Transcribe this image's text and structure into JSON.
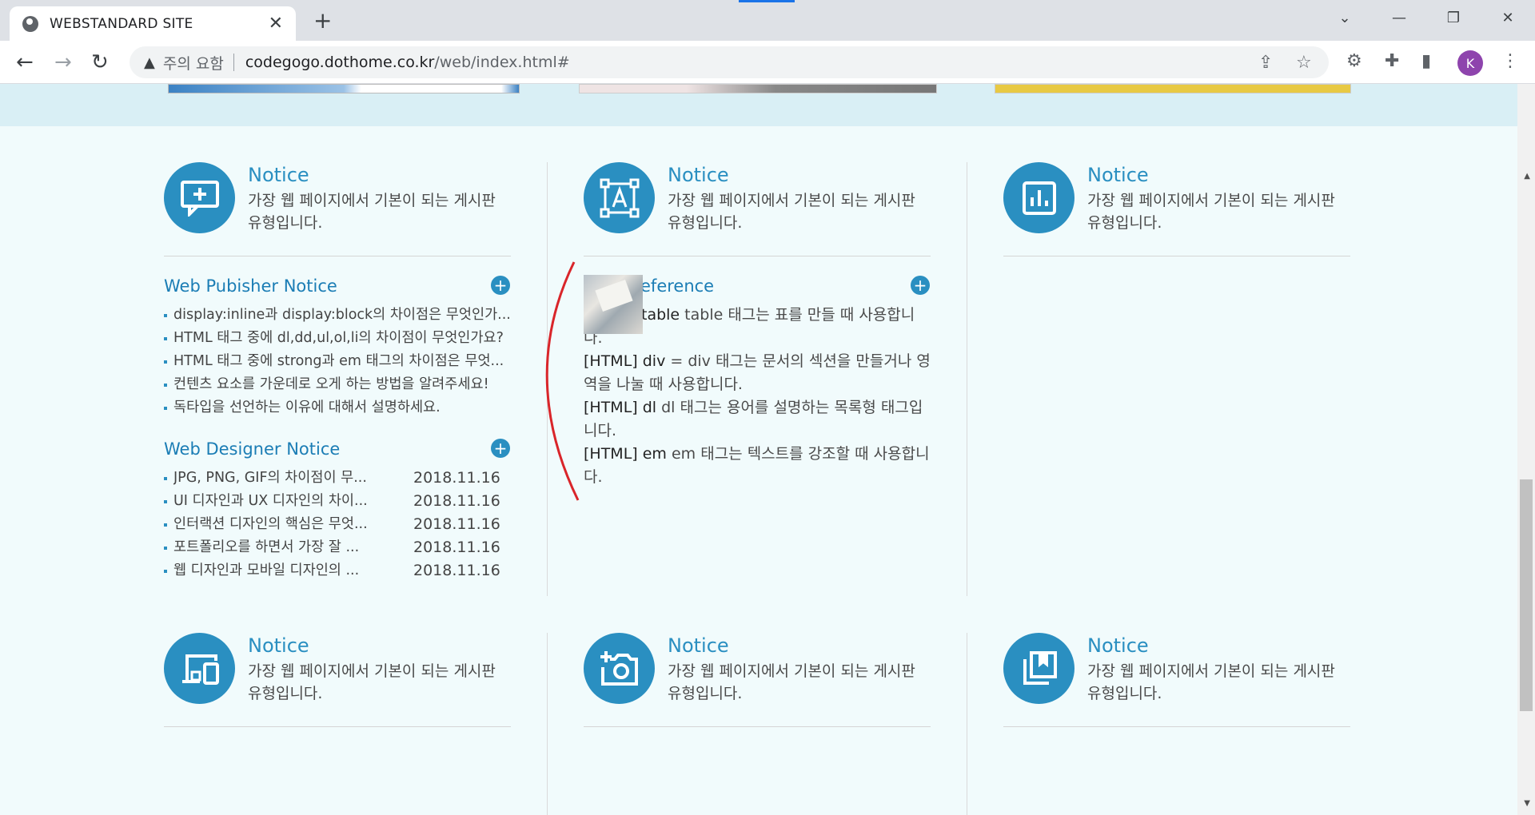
{
  "browser": {
    "tab_title": "WEBSTANDARD SITE",
    "security_warning": "주의 요함",
    "url_host": "codegogo.dothome.co.kr",
    "url_path": "/web/index.html#",
    "profile_initial": "K"
  },
  "columns": {
    "row1": [
      {
        "title": "Notice",
        "desc": "가장 웹 페이지에서 기본이 되는 게시판 유형입니다.",
        "icon": "add-comment-icon"
      },
      {
        "title": "Notice",
        "desc": "가장 웹 페이지에서 기본이 되는 게시판 유형입니다.",
        "icon": "text-frame-icon"
      },
      {
        "title": "Notice",
        "desc": "가장 웹 페이지에서 기본이 되는 게시판 유형입니다.",
        "icon": "bar-chart-icon"
      }
    ],
    "row2": [
      {
        "title": "Notice",
        "desc": "가장 웹 페이지에서 기본이 되는 게시판 유형입니다.",
        "icon": "devices-icon"
      },
      {
        "title": "Notice",
        "desc": "가장 웹 페이지에서 기본이 되는 게시판 유형입니다.",
        "icon": "add-photo-icon"
      },
      {
        "title": "Notice",
        "desc": "가장 웹 페이지에서 기본이 되는 게시판 유형입니다.",
        "icon": "bookmarks-icon"
      }
    ]
  },
  "publisher": {
    "heading": "Web Pubisher Notice",
    "items": [
      "display:inline과 display:block의 차이점은 무엇인가...",
      "HTML 태그 중에 dl,dd,ul,ol,li의 차이점이 무엇인가요?",
      "HTML 태그 중에 strong과 em 태그의 차이점은 무엇...",
      "컨텐츠 요소를 가운데로 오게 하는 방법을 알려주세요!",
      "독타입을 선언하는 이유에 대해서 설명하세요."
    ]
  },
  "designer": {
    "heading": "Web Designer Notice",
    "items": [
      {
        "title": "JPG, PNG, GIF의 차이점이 무...",
        "date": "2018.11.16"
      },
      {
        "title": "UI 디자인과 UX 디자인의 차이...",
        "date": "2018.11.16"
      },
      {
        "title": "인터랙션 디자인의 핵심은 무엇...",
        "date": "2018.11.16"
      },
      {
        "title": "포트폴리오를 하면서 가장 잘 ...",
        "date": "2018.11.16"
      },
      {
        "title": "웹 디자인과 모바일 디자인의 ...",
        "date": "2018.11.16"
      }
    ]
  },
  "reference": {
    "heading": "eference",
    "items": [
      {
        "tag": "table",
        "text": " table 태그는 표를 만들 때 사용합니다."
      },
      {
        "tag": "[HTML] div",
        "text": " = div 태그는 문서의 섹션을 만들거나 영역을 나눌 때 사용합니다."
      },
      {
        "tag": "[HTML] dl",
        "text": " dl 태그는 용어를 설명하는 목록형 태그입니다."
      },
      {
        "tag": "[HTML] em",
        "text": " em 태그는 텍스트를 강조할 때 사용합니다."
      }
    ]
  },
  "colors": {
    "accent": "#2a8fc1",
    "page_bg": "#f1fbfc",
    "annotation": "#d9252a"
  }
}
